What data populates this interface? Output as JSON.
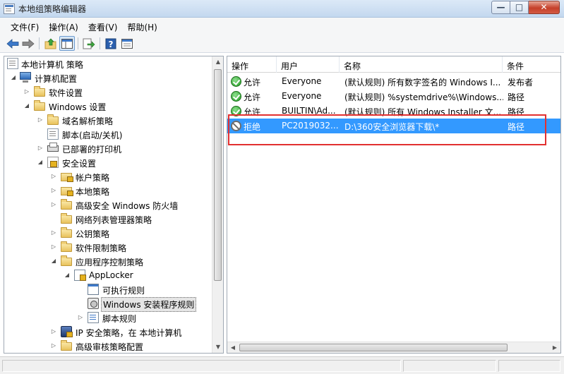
{
  "window": {
    "title": "本地组策略编辑器"
  },
  "menu": [
    "文件(F)",
    "操作(A)",
    "查看(V)",
    "帮助(H)"
  ],
  "toolbar": [
    "back-icon",
    "forward-icon",
    "up-folder-icon",
    "show-hide-tree-icon",
    "export-icon",
    "help-icon",
    "properties-icon"
  ],
  "tree": {
    "root": "本地计算机 策略",
    "computer_config": "计算机配置",
    "software_settings": "软件设置",
    "windows_settings": "Windows 设置",
    "name_resolution": "域名解析策略",
    "scripts_startup": "脚本(启动/关机)",
    "deployed_printers": "已部署的打印机",
    "security_settings": "安全设置",
    "account_policies": "帐户策略",
    "local_policies": "本地策略",
    "firewall": "高级安全 Windows 防火墙",
    "network_list": "网络列表管理器策略",
    "public_key": "公钥策略",
    "software_restriction": "软件限制策略",
    "app_control": "应用程序控制策略",
    "applocker": "AppLocker",
    "executable_rules": "可执行规则",
    "installer_rules": "Windows 安装程序规则",
    "script_rules": "脚本规则",
    "ip_security": "IP 安全策略，在 本地计算机",
    "advanced_audit": "高级审核策略配置"
  },
  "list": {
    "columns": [
      "操作",
      "用户",
      "名称",
      "条件"
    ],
    "rows": [
      {
        "action": "允许",
        "user": "Everyone",
        "name": "(默认规则) 所有数字签名的 Windows I...",
        "condition": "发布者",
        "icon": "allow-icon"
      },
      {
        "action": "允许",
        "user": "Everyone",
        "name": "(默认规则) %systemdrive%\\Windows...",
        "condition": "路径",
        "icon": "allow-icon"
      },
      {
        "action": "允许",
        "user": "BUILTIN\\Ad...",
        "name": "(默认规则) 所有 Windows Installer 文...",
        "condition": "路径",
        "icon": "allow-icon"
      },
      {
        "action": "拒绝",
        "user": "PC2019032...",
        "name": "D:\\360安全浏览器下载\\*",
        "condition": "路径",
        "icon": "deny-icon"
      }
    ]
  },
  "colors": {
    "selection": "#3399ff",
    "highlight_box": "#e23030"
  }
}
